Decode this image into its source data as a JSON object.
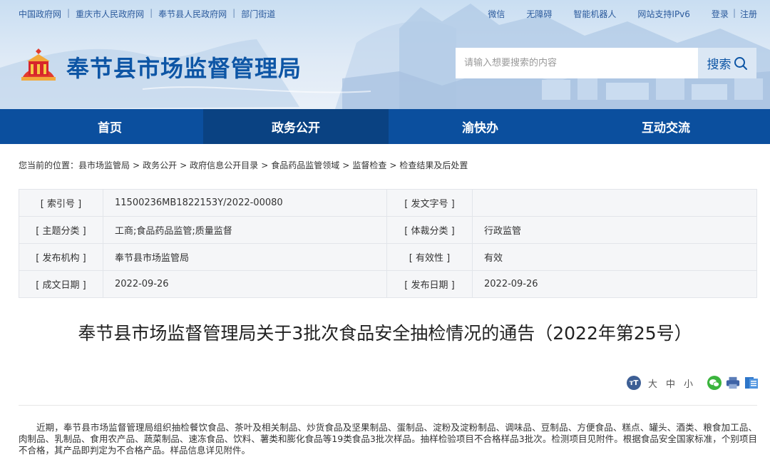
{
  "topbar": {
    "links_left": [
      "中国政府网",
      "重庆市人民政府网",
      "奉节县人民政府网",
      "部门街道"
    ],
    "links_right": [
      "微信",
      "无障碍",
      "智能机器人",
      "网站支持IPv6"
    ],
    "login": "登录",
    "register": "注册",
    "link_color": "#2b5a9c"
  },
  "header": {
    "site_title": "奉节县市场监督管理局",
    "title_color": "#0d55a5",
    "logo_icon": "government-emblem-icon"
  },
  "search": {
    "placeholder": "请输入想要搜索的内容",
    "button_label": "搜索",
    "button_icon": "search-icon"
  },
  "nav": {
    "items": [
      "首页",
      "政务公开",
      "渝快办",
      "互动交流"
    ],
    "active_index": 1,
    "bg_color": "#0b4f9e"
  },
  "breadcrumb": {
    "prefix": "您当前的位置：",
    "items": [
      "县市场监管局",
      "政务公开",
      "政府信息公开目录",
      "食品药品监管领域",
      "监督检查",
      "检查结果及后处置"
    ],
    "separator": ">"
  },
  "meta": {
    "rows": [
      [
        "[ 索引号 ]",
        "11500236MB1822153Y/2022-00080",
        "[ 发文字号 ]",
        ""
      ],
      [
        "[ 主题分类 ]",
        "工商;食品药品监管;质量监督",
        "[ 体裁分类 ]",
        "行政监管"
      ],
      [
        "[ 发布机构 ]",
        "奉节县市场监管局",
        "[ 有效性 ]",
        "有效"
      ],
      [
        "[ 成文日期 ]",
        "2022-09-26",
        "[ 发布日期 ]",
        "2022-09-26"
      ]
    ]
  },
  "article": {
    "title": "奉节县市场监督管理局关于3批次食品安全抽检情况的通告（2022年第25号）",
    "font_size_label_big": "大",
    "font_size_label_mid": "中",
    "font_size_label_small": "小",
    "font_icon_text": "тT",
    "body": "近期，奉节县市场监督管理局组织抽检餐饮食品、茶叶及相关制品、炒货食品及坚果制品、蛋制品、淀粉及淀粉制品、调味品、豆制品、方便食品、糕点、罐头、酒类、粮食加工品、肉制品、乳制品、食用农产品、蔬菜制品、速冻食品、饮料、薯类和膨化食品等19类食品3批次样品。抽样检验项目不合格样品3批次。检测项目见附件。根据食品安全国家标准，个别项目不合格，其产品即判定为不合格产品。样品信息详见附件。"
  }
}
